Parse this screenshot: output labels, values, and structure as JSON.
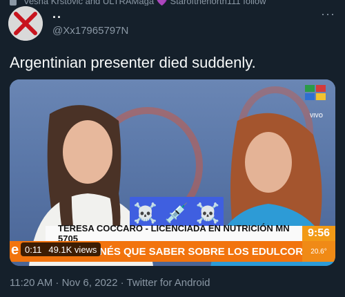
{
  "retweet": {
    "text": "Vesna Krstovic and ULTRAMaga 💜 Starofthenorth111 follow"
  },
  "author": {
    "display_name": "..",
    "handle": "@Xx17965797N"
  },
  "tweet": {
    "text": "Argentinian presenter died suddenly."
  },
  "media": {
    "emoji": [
      "☠️",
      "💉",
      "☠️"
    ],
    "lower_third_name": "TERESA COCCARO - LICENCIADA EN NUTRICIÓN MN 5705",
    "clock": "9:56",
    "ticker_text": "NÉS QUE SABER SOBRE LOS EDULCORANTES",
    "ticker_prefix": "e",
    "temperature": "20.6°",
    "live_tag": "VIVO",
    "duration": "0:11",
    "views": "49.1K views"
  },
  "meta": {
    "line": "11:20 AM · Nov 6, 2022 · Twitter for Android"
  },
  "colors": {
    "background": "#15202b",
    "text": "#f7f9f9",
    "muted": "#8b98a5",
    "ticker": "#f2740e"
  }
}
